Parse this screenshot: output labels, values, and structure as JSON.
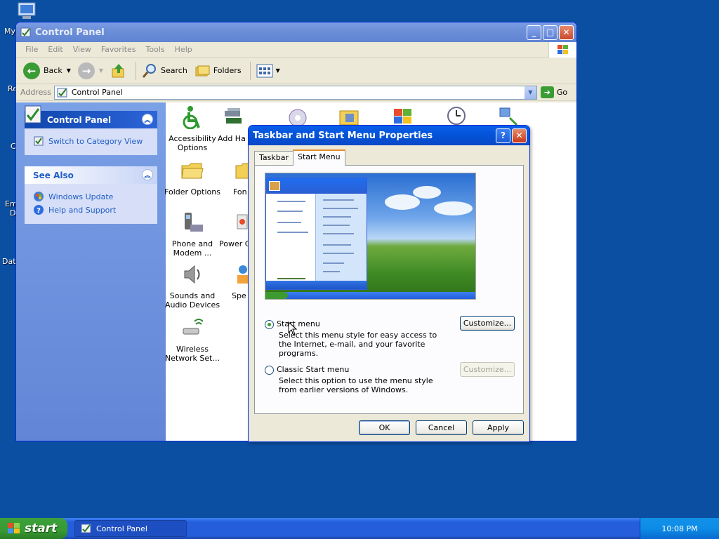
{
  "desktop": {
    "icon_fragments": [
      "My",
      "Re",
      "C",
      "Em",
      "D",
      "Dat"
    ]
  },
  "control_panel": {
    "title": "Control Panel",
    "menu": [
      "File",
      "Edit",
      "View",
      "Favorites",
      "Tools",
      "Help"
    ],
    "toolbar": {
      "back": "Back",
      "search": "Search",
      "folders": "Folders"
    },
    "address": {
      "label": "Address",
      "value": "Control Panel",
      "go": "Go"
    },
    "left_panel": {
      "main_title": "Control Panel",
      "switch_view": "Switch to Category View",
      "see_also_title": "See Also",
      "see_also_items": [
        "Windows Update",
        "Help and Support"
      ]
    },
    "items": [
      {
        "label": "Accessibility Options"
      },
      {
        "label": "Add Ha"
      },
      {
        "label": "Folder Options"
      },
      {
        "label": "Fon"
      },
      {
        "label": "Phone and Modem ..."
      },
      {
        "label": "Power C"
      },
      {
        "label": "Sounds and Audio Devices"
      },
      {
        "label": "Spe"
      },
      {
        "label": "Wireless Network Set..."
      }
    ]
  },
  "dialog": {
    "title": "Taskbar and Start Menu Properties",
    "tabs": [
      "Taskbar",
      "Start Menu"
    ],
    "active_tab": "Start Menu",
    "options": [
      {
        "label": "Start menu",
        "description": "Select this menu style for easy access to the Internet, e-mail, and your favorite programs.",
        "selected": true,
        "button": "Customize...",
        "button_enabled": true
      },
      {
        "label": "Classic Start menu",
        "description": "Select this option to use the menu style from earlier versions of Windows.",
        "selected": false,
        "button": "Customize...",
        "button_enabled": false
      }
    ],
    "buttons": {
      "ok": "OK",
      "cancel": "Cancel",
      "apply": "Apply"
    }
  },
  "taskbar": {
    "start": "start",
    "task": "Control Panel",
    "clock": "10:08 PM"
  },
  "colors": {
    "desktop": "#0b4fa3",
    "titlebar_active": "#0a5eea",
    "start_button": "#3ca03c",
    "tray": "#0d8ce6"
  }
}
